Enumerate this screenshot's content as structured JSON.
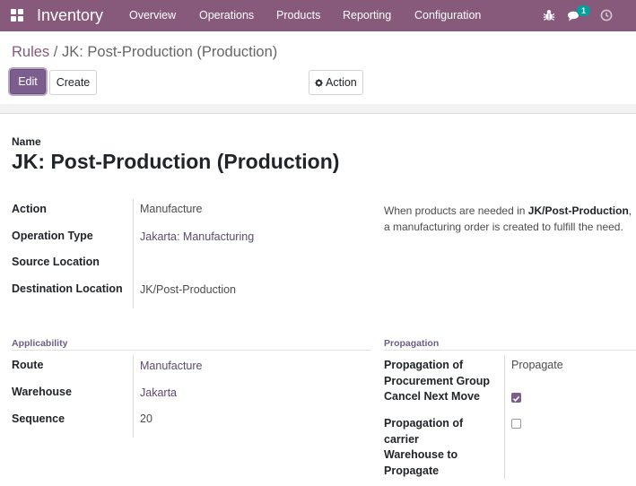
{
  "navbar": {
    "app_name": "Inventory",
    "menu": [
      "Overview",
      "Operations",
      "Products",
      "Reporting",
      "Configuration"
    ],
    "messages_badge": "1",
    "icons": [
      "apps-icon",
      "bug-icon",
      "chat-icon",
      "clock-icon"
    ]
  },
  "breadcrumb": {
    "parent": "Rules",
    "separator": "/",
    "current": "JK: Post-Production (Production)"
  },
  "buttons": {
    "edit": "Edit",
    "create": "Create",
    "action": "Action"
  },
  "form": {
    "name_label": "Name",
    "name_value": "JK: Post-Production (Production)",
    "fields": {
      "action": {
        "label": "Action",
        "value": "Manufacture"
      },
      "operation_type": {
        "label": "Operation Type",
        "value": "Jakarta: Manufacturing"
      },
      "source_location": {
        "label": "Source Location",
        "value": ""
      },
      "destination_location": {
        "label": "Destination Location",
        "value": "JK/Post-Production"
      }
    },
    "hint": {
      "prefix": "When products are needed in ",
      "location": "JK/Post-Production",
      "suffix": ", a manufacturing order is created to fulfill the need."
    },
    "applicability": {
      "title": "Applicability",
      "route": {
        "label": "Route",
        "value": "Manufacture"
      },
      "warehouse": {
        "label": "Warehouse",
        "value": "Jakarta"
      },
      "sequence": {
        "label": "Sequence",
        "value": "20"
      }
    },
    "propagation": {
      "title": "Propagation",
      "procurement_group": {
        "label_line1": "Propagation of",
        "label_line2": "Procurement Group",
        "value": "Propagate"
      },
      "cancel_next_move": {
        "label": "Cancel Next Move",
        "checked": true
      },
      "carrier": {
        "label_line1": "Propagation of",
        "label_line2": "carrier",
        "checked": false
      },
      "warehouse_to_propagate": {
        "label_line1": "Warehouse to",
        "label_line2": "Propagate",
        "value": ""
      }
    }
  },
  "colors": {
    "brand": "#875a7b",
    "primary_button": "#7c5e8e",
    "badge": "#00a09d",
    "link": "#5c4972"
  }
}
